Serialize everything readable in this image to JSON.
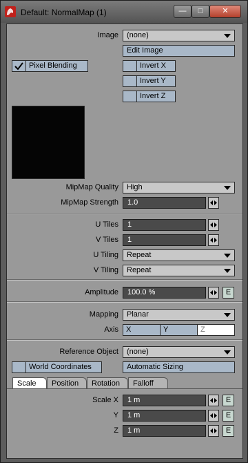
{
  "window": {
    "title": "Default: NormalMap (1)",
    "minimize_glyph": "—",
    "maximize_glyph": "□",
    "close_glyph": "✕"
  },
  "image": {
    "label": "Image",
    "value": "(none)",
    "edit_button": "Edit Image",
    "pixel_blending": {
      "label": "Pixel Blending",
      "checked": true
    },
    "invert": [
      {
        "label": "Invert X",
        "checked": false
      },
      {
        "label": "Invert Y",
        "checked": false
      },
      {
        "label": "Invert Z",
        "checked": false
      }
    ]
  },
  "mipmap": {
    "quality_label": "MipMap Quality",
    "quality_value": "High",
    "strength_label": "MipMap Strength",
    "strength_value": "1.0"
  },
  "tiles": {
    "u_tiles_label": "U Tiles",
    "u_tiles_value": "1",
    "v_tiles_label": "V Tiles",
    "v_tiles_value": "1",
    "u_tiling_label": "U Tiling",
    "u_tiling_value": "Repeat",
    "v_tiling_label": "V Tiling",
    "v_tiling_value": "Repeat"
  },
  "amplitude": {
    "label": "Amplitude",
    "value": "100.0 %",
    "envelope_label": "E"
  },
  "mapping": {
    "label": "Mapping",
    "value": "Planar",
    "axis_label": "Axis",
    "axes": [
      "X",
      "Y",
      "Z"
    ],
    "selected_axis": "Z"
  },
  "reference": {
    "label": "Reference Object",
    "value": "(none)",
    "world_coordinates": {
      "label": "World Coordinates",
      "checked": false
    },
    "auto_sizing": "Automatic Sizing"
  },
  "tabs": [
    "Scale",
    "Position",
    "Rotation",
    "Falloff"
  ],
  "active_tab": "Scale",
  "scale": [
    {
      "label": "Scale X",
      "value": "1 m",
      "envelope": "E"
    },
    {
      "label": "Y",
      "value": "1 m",
      "envelope": "E"
    },
    {
      "label": "Z",
      "value": "1 m",
      "envelope": "E"
    }
  ],
  "colors": {
    "panel_bg": "#999999",
    "field_bg": "#4a4a4a",
    "button_blue": "#a9b8c8",
    "close_red": "#b3402c"
  }
}
